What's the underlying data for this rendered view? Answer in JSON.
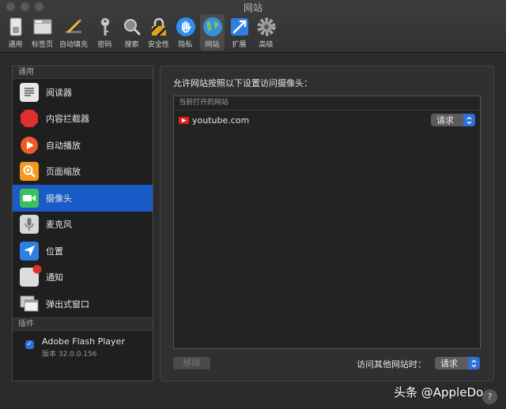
{
  "window": {
    "title": "网站"
  },
  "toolbar": {
    "items": [
      {
        "label": "通用",
        "icon": "switch-icon"
      },
      {
        "label": "标签页",
        "icon": "tabs-icon"
      },
      {
        "label": "自动填充",
        "icon": "pencil-icon"
      },
      {
        "label": "密码",
        "icon": "key-icon"
      },
      {
        "label": "搜索",
        "icon": "magnifier-icon"
      },
      {
        "label": "安全性",
        "icon": "padlock-icon"
      },
      {
        "label": "隐私",
        "icon": "hand-icon"
      },
      {
        "label": "网站",
        "icon": "globe-icon",
        "active": true
      },
      {
        "label": "扩展",
        "icon": "puzzle-icon"
      },
      {
        "label": "高级",
        "icon": "gear-icon"
      }
    ]
  },
  "sidebar": {
    "general_header": "通用",
    "items": [
      {
        "label": "阅读器",
        "icon": "reader-icon"
      },
      {
        "label": "内容拦截器",
        "icon": "stop-sign-icon"
      },
      {
        "label": "自动播放",
        "icon": "play-icon"
      },
      {
        "label": "页面缩放",
        "icon": "zoom-icon"
      },
      {
        "label": "摄像头",
        "icon": "camera-icon",
        "selected": true
      },
      {
        "label": "麦克风",
        "icon": "microphone-icon"
      },
      {
        "label": "位置",
        "icon": "location-arrow-icon"
      },
      {
        "label": "通知",
        "icon": "notification-icon"
      },
      {
        "label": "弹出式窗口",
        "icon": "popup-windows-icon"
      }
    ],
    "plugins_header": "插件",
    "plugin": {
      "name": "Adobe Flash Player",
      "version": "版本 32.0.0.156",
      "checked": true
    }
  },
  "main": {
    "title": "允许网站按照以下设置访问摄像头：",
    "table_header": "当前打开的网站",
    "sites": [
      {
        "name": "youtube.com",
        "setting": "请求"
      }
    ],
    "remove_button": "移除",
    "other_sites_label": "访问其他网站时：",
    "other_sites_setting": "请求"
  },
  "watermark": "头条 @AppleDo",
  "help_label": "?",
  "colors": {
    "accent": "#1a5bc7",
    "stepper": "#2f6fd8",
    "youtube": "#e62117"
  }
}
